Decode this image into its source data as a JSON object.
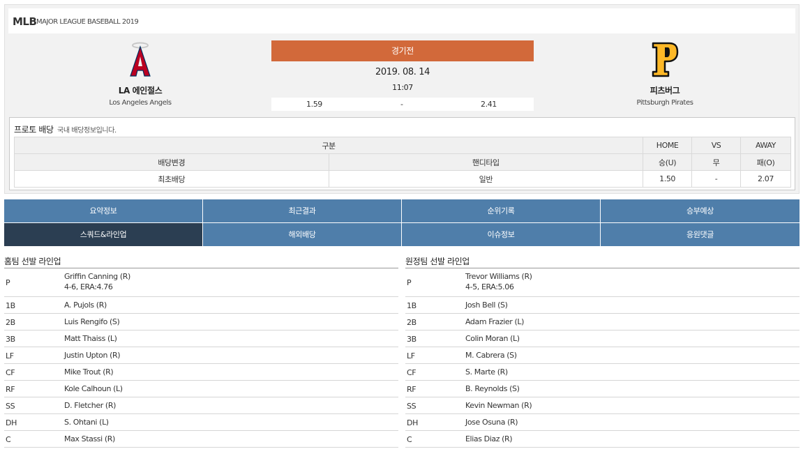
{
  "header": {
    "league": "MLB",
    "subtitle": "MAJOR LEAGUE BASEBALL 2019"
  },
  "home_team": {
    "name_kr": "LA 에인절스",
    "name_en": "Los Angeles Angels",
    "logo_icon": "angels-logo-icon",
    "logo_color": "#ba0021"
  },
  "away_team": {
    "name_kr": "피츠버그",
    "name_en": "Pittsburgh Pirates",
    "logo_icon": "pirates-logo-icon",
    "logo_color": "#fdb827"
  },
  "match": {
    "status": "경기전",
    "date": "2019. 08. 14",
    "time": "11:07",
    "odds": {
      "home": "1.59",
      "draw": "-",
      "away": "2.41"
    },
    "status_color": "#d2693a"
  },
  "proto": {
    "title": "프로토 배당",
    "desc": "국내 배당정보입니다.",
    "header": {
      "category": "구분",
      "home": "HOME",
      "vs": "VS",
      "away": "AWAY"
    },
    "subheader": {
      "odds_change": "배당변경",
      "handicap_type": "핸디타입",
      "win": "승(U)",
      "draw": "무",
      "lose": "패(O)"
    },
    "row": {
      "label": "최초배당",
      "type": "일반",
      "win": "1.50",
      "draw": "-",
      "lose": "2.07"
    }
  },
  "tabs": [
    {
      "label": "요약정보"
    },
    {
      "label": "최근결과"
    },
    {
      "label": "순위기록"
    },
    {
      "label": "승부예상"
    },
    {
      "label": "스쿼드&라인업"
    },
    {
      "label": "해외배당"
    },
    {
      "label": "이슈정보"
    },
    {
      "label": "응원댓글"
    }
  ],
  "active_tab": "스쿼드&라인업",
  "home_lineup": {
    "title": "홈팀 선발 라인업",
    "players": [
      {
        "pos": "P",
        "name": "Griffin Canning (R)",
        "stat": "4-6, ERA:4.76"
      },
      {
        "pos": "1B",
        "name": "A. Pujols (R)"
      },
      {
        "pos": "2B",
        "name": "Luis Rengifo (S)"
      },
      {
        "pos": "3B",
        "name": "Matt Thaiss (L)"
      },
      {
        "pos": "LF",
        "name": "Justin Upton (R)"
      },
      {
        "pos": "CF",
        "name": "Mike Trout (R)"
      },
      {
        "pos": "RF",
        "name": "Kole Calhoun (L)"
      },
      {
        "pos": "SS",
        "name": "D. Fletcher (R)"
      },
      {
        "pos": "DH",
        "name": "S. Ohtani (L)"
      },
      {
        "pos": "C",
        "name": "Max Stassi (R)"
      }
    ]
  },
  "away_lineup": {
    "title": "원정팀 선발 라인업",
    "players": [
      {
        "pos": "P",
        "name": "Trevor Williams (R)",
        "stat": "4-5, ERA:5.06"
      },
      {
        "pos": "1B",
        "name": "Josh Bell (S)"
      },
      {
        "pos": "2B",
        "name": "Adam Frazier (L)"
      },
      {
        "pos": "3B",
        "name": "Colin Moran (L)"
      },
      {
        "pos": "LF",
        "name": "M. Cabrera (S)"
      },
      {
        "pos": "CF",
        "name": "S. Marte (R)"
      },
      {
        "pos": "RF",
        "name": "B. Reynolds (S)"
      },
      {
        "pos": "SS",
        "name": "Kevin Newman (R)"
      },
      {
        "pos": "DH",
        "name": "Jose Osuna (R)"
      },
      {
        "pos": "C",
        "name": "Elias Diaz (R)"
      }
    ]
  }
}
